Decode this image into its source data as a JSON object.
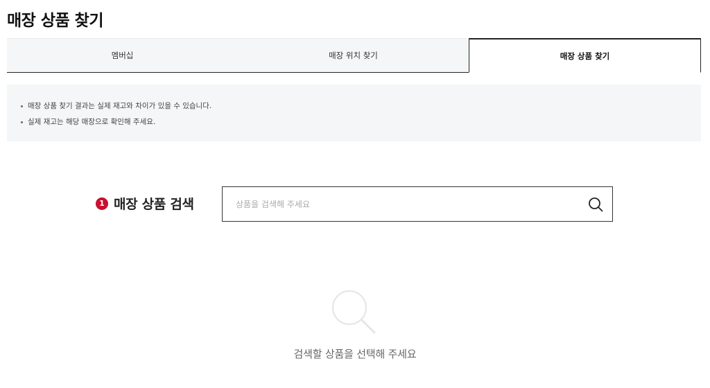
{
  "page": {
    "title": "매장 상품 찾기"
  },
  "tabs": [
    {
      "label": "멤버십",
      "active": false
    },
    {
      "label": "매장 위치 찾기",
      "active": false
    },
    {
      "label": "매장 상품 찾기",
      "active": true
    }
  ],
  "notice": {
    "items": [
      "매장 상품 찾기 결과는 실제 재고와 차이가 있을 수 있습니다.",
      "실제 재고는 해당 매장으로 확인해 주세요."
    ]
  },
  "search": {
    "step": "1",
    "label": "매장 상품 검색",
    "placeholder": "상품을 검색해 주세요",
    "value": ""
  },
  "empty": {
    "message": "검색할 상품을 선택해 주세요"
  },
  "colors": {
    "accent": "#c8102e",
    "tab_bg": "#f4f6f7",
    "notice_bg": "#f4f6f7"
  },
  "icons": {
    "search": "search-icon",
    "empty": "magnifier-empty-icon"
  }
}
